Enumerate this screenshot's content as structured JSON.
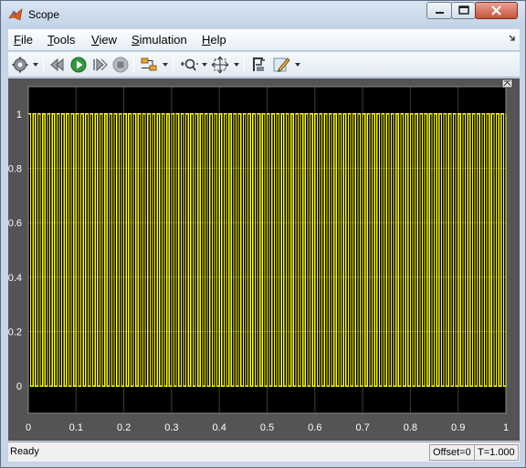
{
  "window": {
    "title": "Scope"
  },
  "menu": [
    {
      "label": "File",
      "underline": "F",
      "rest": "ile"
    },
    {
      "label": "Tools",
      "underline": "T",
      "rest": "ools"
    },
    {
      "label": "View",
      "underline": "V",
      "rest": "iew"
    },
    {
      "label": "Simulation",
      "underline": "S",
      "rest": "imulation"
    },
    {
      "label": "Help",
      "underline": "H",
      "rest": "elp"
    }
  ],
  "toolbar": {
    "icons": [
      "settings-gear-icon",
      "step-back-icon",
      "run-icon",
      "step-forward-icon",
      "stop-icon",
      "signal-selector-icon",
      "zoom-icon",
      "autoscale-icon",
      "triggers-icon",
      "style-icon"
    ]
  },
  "chart_data": {
    "type": "line",
    "title": "",
    "xlabel": "",
    "ylabel": "",
    "xlim": [
      0,
      1
    ],
    "ylim": [
      -0.1,
      1.1
    ],
    "x_ticks": [
      "0",
      "0.1",
      "0.2",
      "0.3",
      "0.4",
      "0.5",
      "0.6",
      "0.7",
      "0.8",
      "0.9",
      "1"
    ],
    "y_ticks": [
      "0",
      "0.2",
      "0.4",
      "0.6",
      "0.8",
      "1"
    ],
    "grid": true,
    "series": [
      {
        "signal": "square wave",
        "low": 0,
        "high": 1,
        "period": 0.01,
        "duty": 0.5,
        "color": "#ffff00"
      }
    ],
    "background": "#000000"
  },
  "status": {
    "text": "Ready",
    "offset": "Offset=0",
    "time": "T=1.000"
  }
}
